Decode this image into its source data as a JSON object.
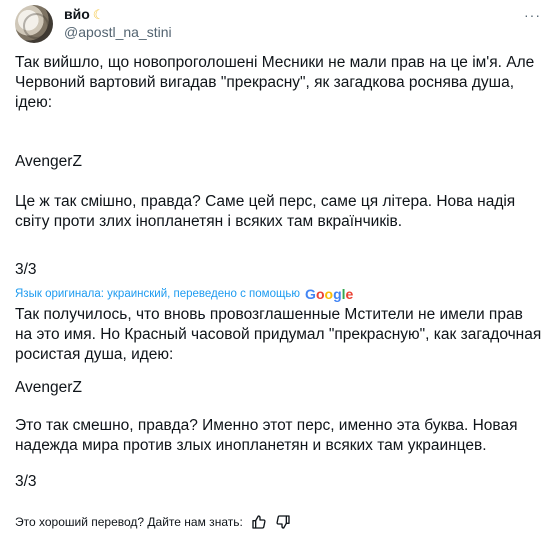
{
  "author": {
    "display_name": "вйо",
    "handle": "@apostl_na_stini",
    "badge_icon": "crescent-moon-icon"
  },
  "header": {
    "more_label": "···"
  },
  "original": {
    "p1": "Так вийшло, що новопроголошені Месники не мали прав на це ім'я. Але Червоний вартовий вигадав \"прекрасну\", як загадкова роснява душа, ідею:",
    "p2": "AvengerZ",
    "p3": "Це ж так смішно, правда? Саме цей перс, саме ця літера. Нова надія світу проти злих інопланетян і всяких там вкраїнчиків.",
    "p4": "3/3"
  },
  "translation_note": {
    "text": "Язык оригинала: украинский, переведено с помощью",
    "provider": "Google"
  },
  "translated": {
    "p1": "Так получилось, что вновь провозглашенные Мстители не имели прав на это имя. Но Красный часовой придумал \"прекрасную\", как загадочная росистая душа, идею:",
    "p2": "AvengerZ",
    "p3": "Это так смешно, правда? Именно этот перс, именно эта буква. Новая надежда мира против злых инопланетян и всяких там украинцев.",
    "p4": "3/3"
  },
  "feedback": {
    "prompt": "Это хороший перевод? Дайте нам знать:",
    "like_icon": "thumbs-up-icon",
    "dislike_icon": "thumbs-down-icon"
  }
}
